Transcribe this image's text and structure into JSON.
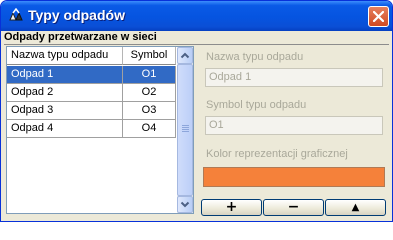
{
  "window": {
    "title": "Typy odpadów",
    "close_symbol": "×"
  },
  "section": {
    "title": "Odpady przetwarzane w sieci"
  },
  "list": {
    "columns": [
      "Nazwa typu odpadu",
      "Symbol"
    ],
    "rows": [
      {
        "name": "Odpad 1",
        "symbol": "O1",
        "selected": true
      },
      {
        "name": "Odpad 2",
        "symbol": "O2",
        "selected": false
      },
      {
        "name": "Odpad 3",
        "symbol": "O3",
        "selected": false
      },
      {
        "name": "Odpad 4",
        "symbol": "O4",
        "selected": false
      }
    ]
  },
  "form": {
    "name_label": "Nazwa typu odpadu",
    "name_value": "Odpad 1",
    "symbol_label": "Symbol typu odpadu",
    "symbol_value": "O1",
    "color_label": "Kolor reprezentacji graficznej",
    "color_value": "#f5813a"
  },
  "buttons": {
    "add": "+",
    "remove": "−",
    "up": "▲"
  },
  "colors": {
    "titlebar": "#0a5ae6",
    "selection": "#316ac5",
    "close": "#d24a22"
  },
  "icons": {
    "app": "recycle-icon",
    "close": "close-icon",
    "scroll_up": "chevron-up-icon",
    "scroll_down": "chevron-down-icon"
  }
}
